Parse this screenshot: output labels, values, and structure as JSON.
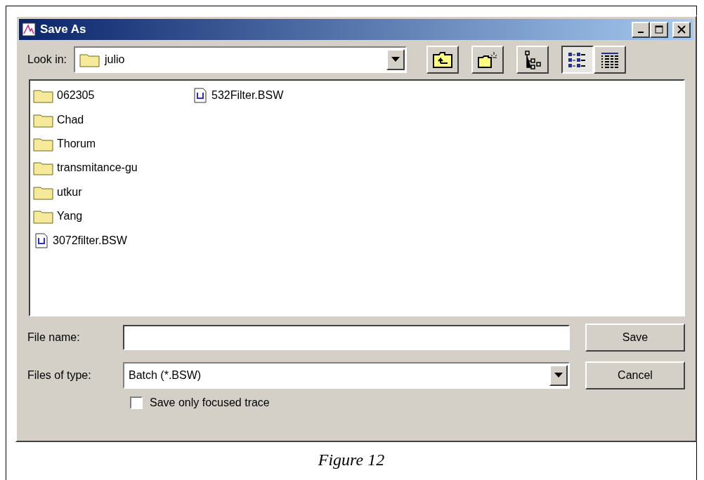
{
  "window": {
    "title": "Save As"
  },
  "look_in": {
    "label": "Look in:",
    "value": "julio"
  },
  "view_buttons": [
    {
      "kind": "list",
      "selected": true
    },
    {
      "kind": "details",
      "selected": false
    }
  ],
  "files": [
    {
      "kind": "folder",
      "name": "062305"
    },
    {
      "kind": "folder",
      "name": "Chad"
    },
    {
      "kind": "folder",
      "name": "Thorum"
    },
    {
      "kind": "folder",
      "name": "transmitance-gu"
    },
    {
      "kind": "folder",
      "name": "utkur"
    },
    {
      "kind": "folder",
      "name": "Yang"
    },
    {
      "kind": "file",
      "name": "3072filter.BSW"
    },
    {
      "kind": "file",
      "name": "532Filter.BSW"
    }
  ],
  "file_name": {
    "label": "File name:"
  },
  "file_type": {
    "label": "Files of type:",
    "value": "Batch (*.BSW)"
  },
  "buttons": [
    "Save",
    "Cancel"
  ],
  "option": {
    "label": "Save only focused trace",
    "checked": false
  },
  "caption": "Figure 12"
}
